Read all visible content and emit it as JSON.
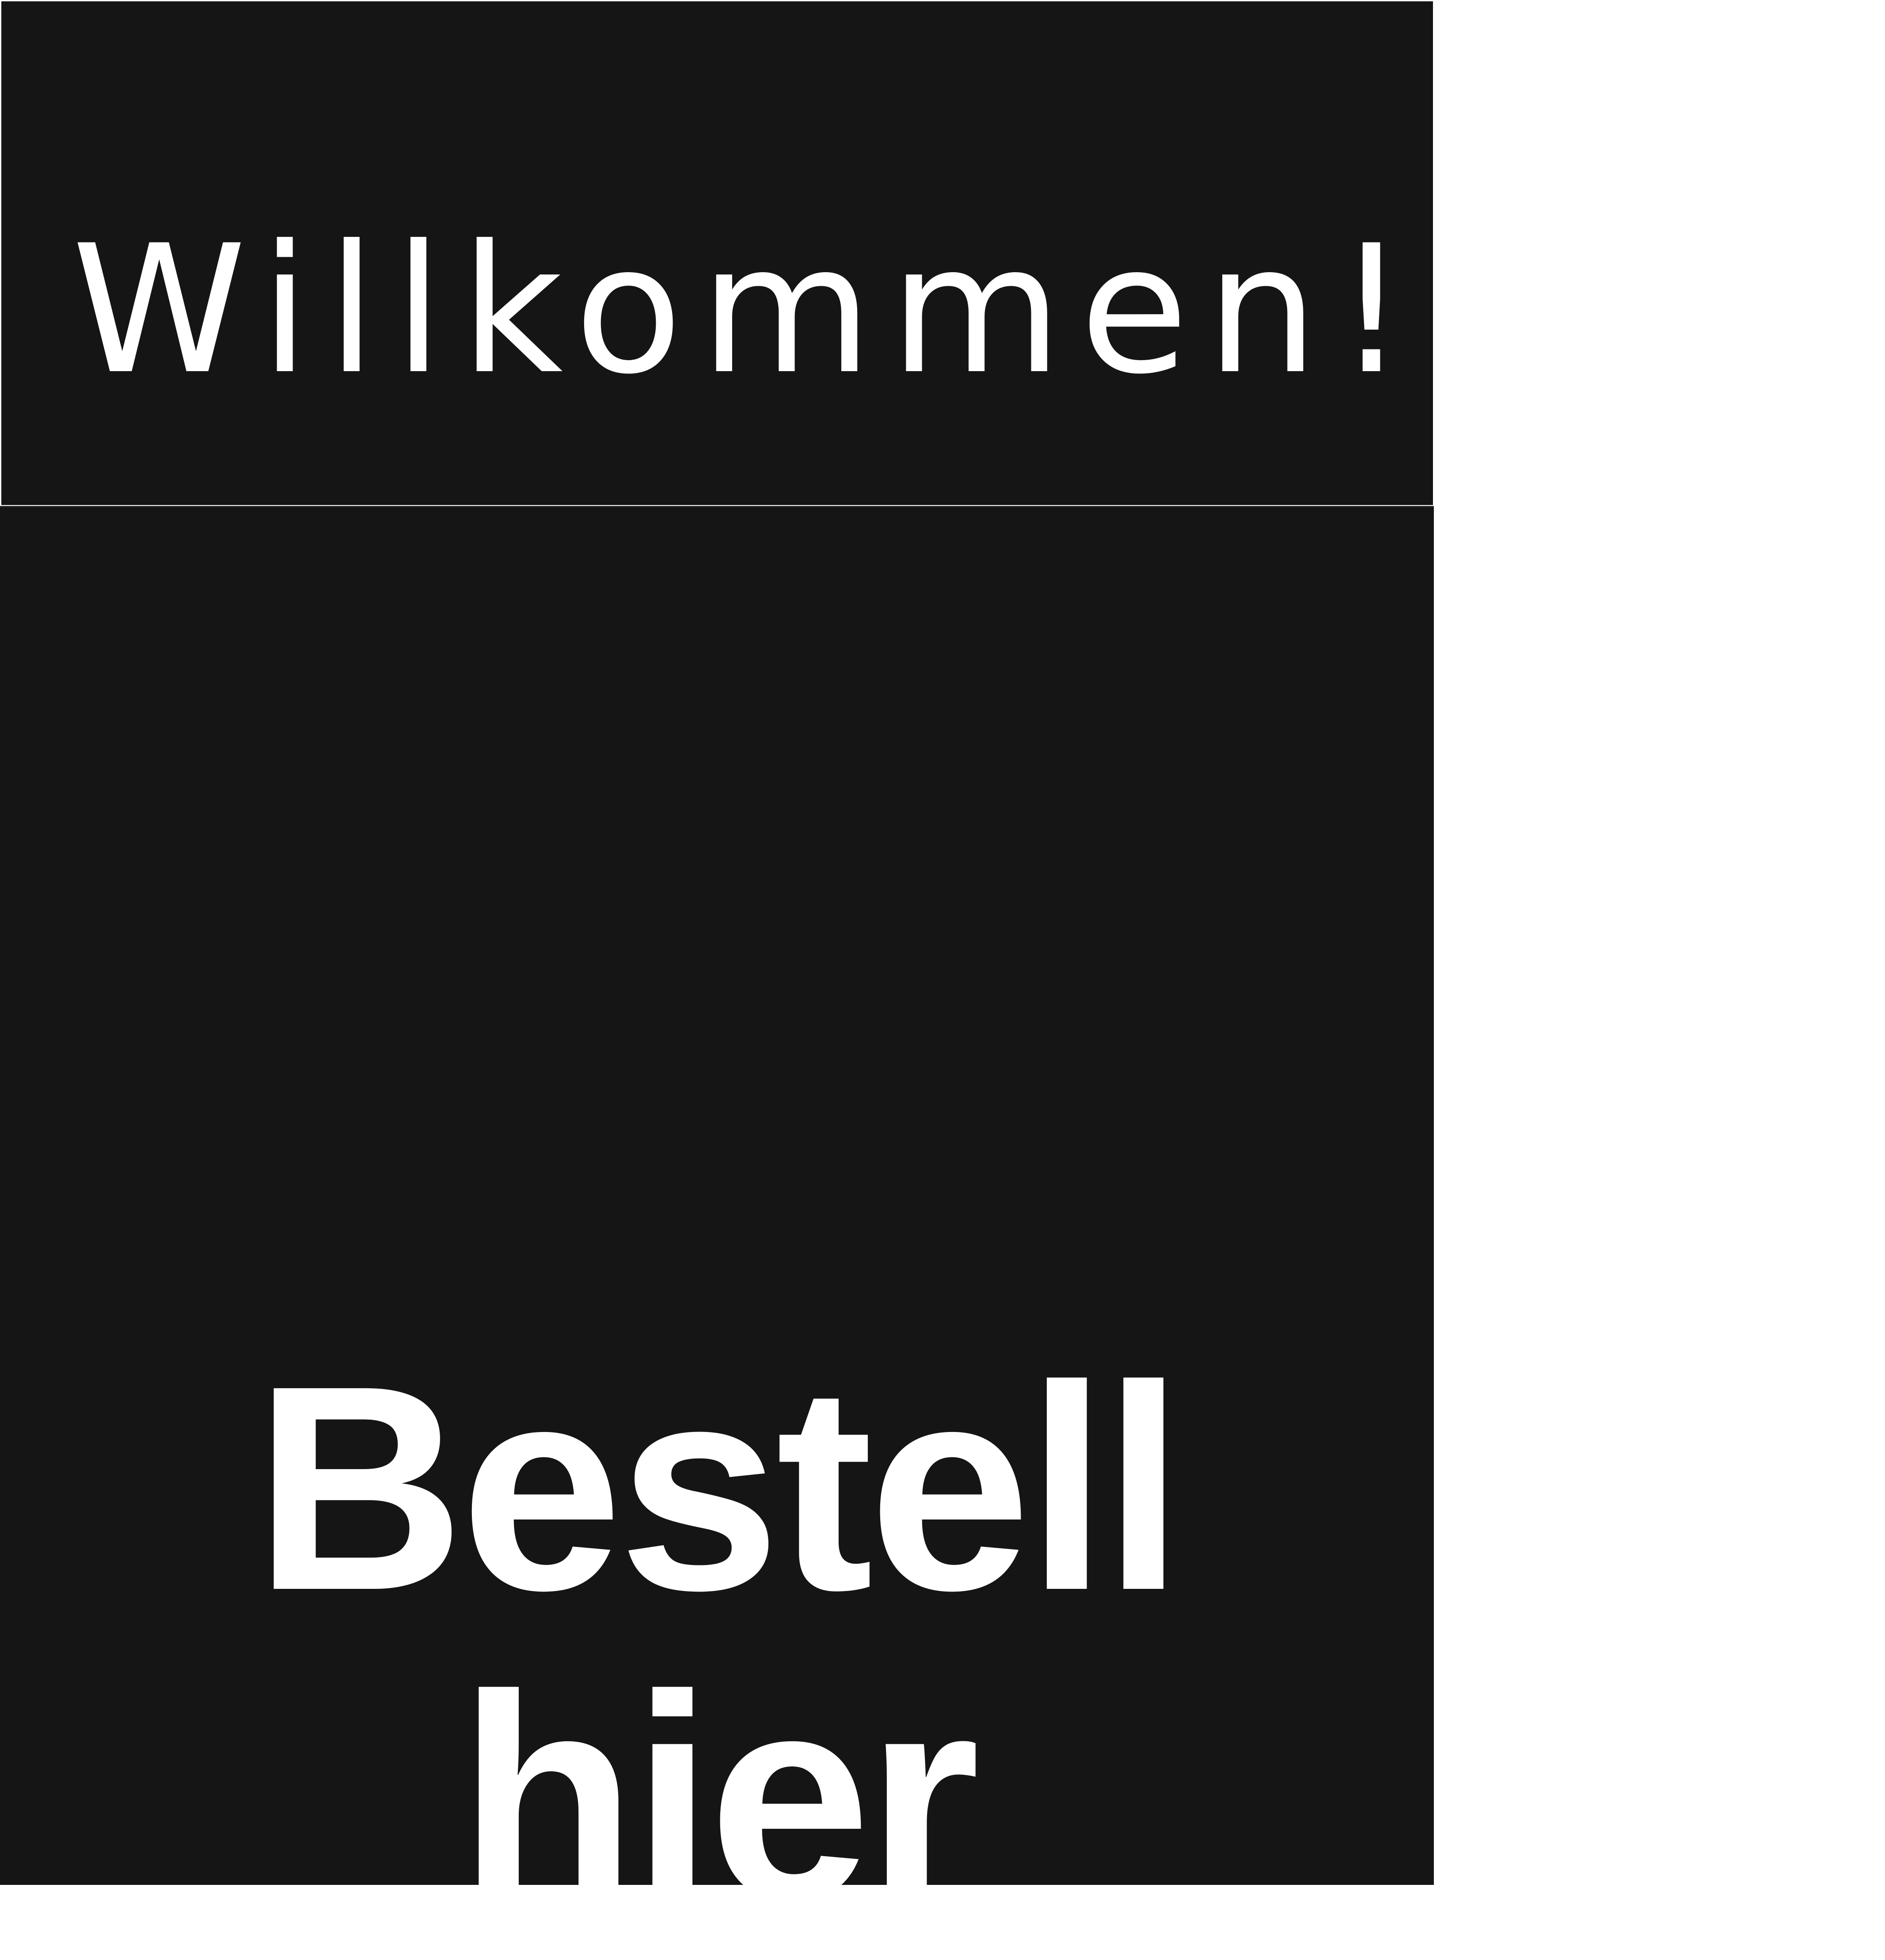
{
  "header": {
    "title": "Willkommen!"
  },
  "main": {
    "headline_line1": "Bestell",
    "headline_line2": "hier"
  },
  "colors": {
    "panel": "#151515",
    "text": "#ffffff",
    "background": "#ffffff"
  }
}
